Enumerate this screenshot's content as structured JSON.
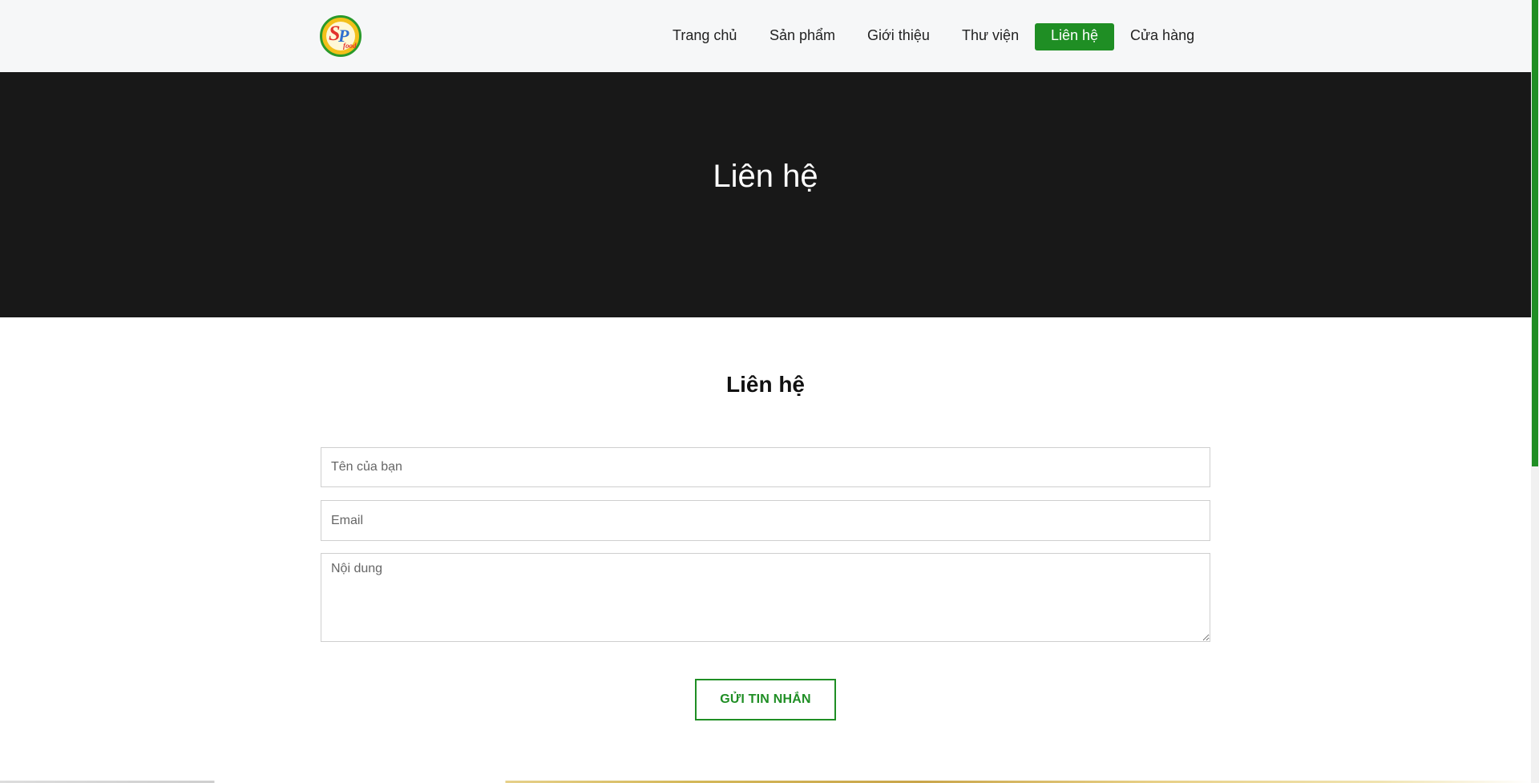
{
  "brand": {
    "logo_letters": "SP",
    "logo_sub": "food",
    "colors": {
      "accent": "#1f8e24",
      "hero_bg": "#181818",
      "header_bg": "#f6f7f8"
    }
  },
  "nav": {
    "items": [
      {
        "label": "Trang chủ"
      },
      {
        "label": "Sản phẩm"
      },
      {
        "label": "Giới thiệu"
      },
      {
        "label": "Thư viện"
      },
      {
        "label": "Liên hệ",
        "active": true
      },
      {
        "label": "Cửa hàng"
      }
    ]
  },
  "hero": {
    "title": "Liên hệ"
  },
  "contact": {
    "title": "Liên hệ",
    "name_placeholder": "Tên của bạn",
    "email_placeholder": "Email",
    "message_placeholder": "Nội dung",
    "submit_label": "GỬI TIN NHẮN"
  }
}
